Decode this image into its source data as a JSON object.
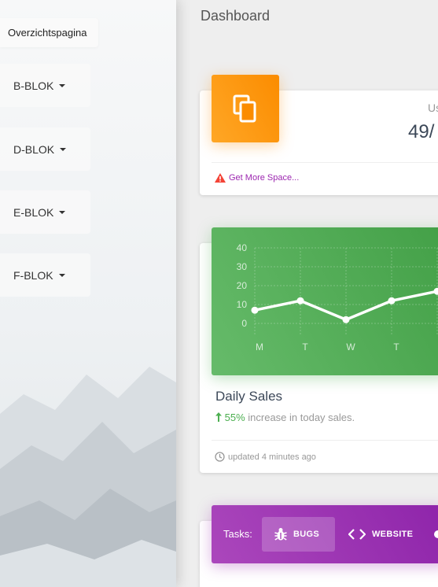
{
  "sidebar": {
    "items": [
      {
        "label": "Overzichtspagina"
      },
      {
        "label": "B-BLOK"
      },
      {
        "label": "D-BLOK"
      },
      {
        "label": "E-BLOK"
      },
      {
        "label": "F-BLOK"
      }
    ]
  },
  "page": {
    "title": "Dashboard"
  },
  "storage_card": {
    "label": "Us",
    "value": "49/",
    "icon": "copy-icon",
    "footer_icon": "warning-icon",
    "footer_link": "Get More Space..."
  },
  "sales_card": {
    "title": "Daily Sales",
    "increase_pct": "55%",
    "increase_text": " increase in today sales.",
    "footer_icon": "clock-icon",
    "footer_text": "updated 4 minutes ago"
  },
  "chart_data": {
    "type": "line",
    "categories": [
      "M",
      "T",
      "W",
      "T",
      ""
    ],
    "values": [
      7,
      12,
      2,
      12,
      17
    ],
    "ylim": [
      0,
      40
    ],
    "yticks": [
      0,
      10,
      20,
      30,
      40
    ],
    "grid": true,
    "color": "#ffffff"
  },
  "tasks": {
    "label": "Tasks:",
    "tabs": [
      {
        "label": "BUGS",
        "icon": "bug-icon"
      },
      {
        "label": "WEBSITE",
        "icon": "code-icon"
      }
    ]
  },
  "colors": {
    "orange": "#fb8c00",
    "green": "#43a047",
    "purple": "#9c27b0",
    "warning": "#f44336"
  }
}
